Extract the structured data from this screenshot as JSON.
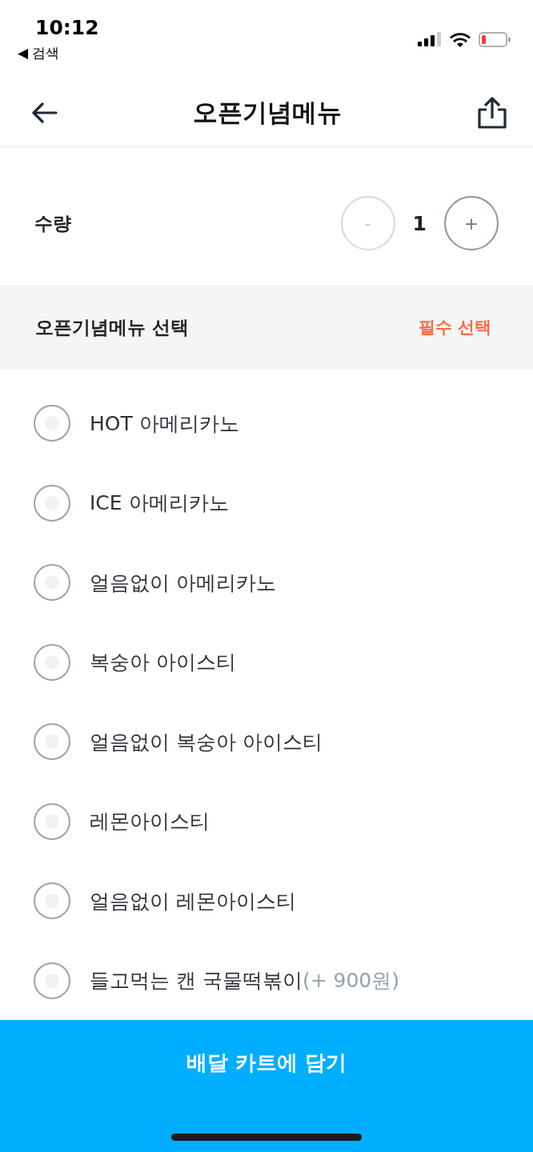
{
  "status_bar": {
    "time": "10:12",
    "back_app": "◀ 검색"
  },
  "header": {
    "title": "오픈기념메뉴"
  },
  "quantity": {
    "label": "수량",
    "value": "1",
    "minus": {
      "label": "-",
      "disabled": true
    },
    "plus": {
      "label": "+",
      "disabled": false
    }
  },
  "option_group": {
    "title": "오픈기념메뉴 선택",
    "badge": "필수 선택"
  },
  "options": [
    {
      "label": "HOT 아메리카노",
      "selected": false
    },
    {
      "label": "ICE 아메리카노",
      "selected": false
    },
    {
      "label": "얼음없이 아메리카노",
      "selected": false
    },
    {
      "label": "복숭아 아이스티",
      "selected": false
    },
    {
      "label": "얼음없이 복숭아 아이스티",
      "selected": false
    },
    {
      "label": "레몬아이스티",
      "selected": false
    },
    {
      "label": "얼음없이 레몬아이스티",
      "selected": false
    },
    {
      "label": "들고먹는 캔 국물떡볶이",
      "extra": "(+ 900원)",
      "selected": false
    }
  ],
  "cart_button": {
    "label": "배달 카트에 담기"
  }
}
